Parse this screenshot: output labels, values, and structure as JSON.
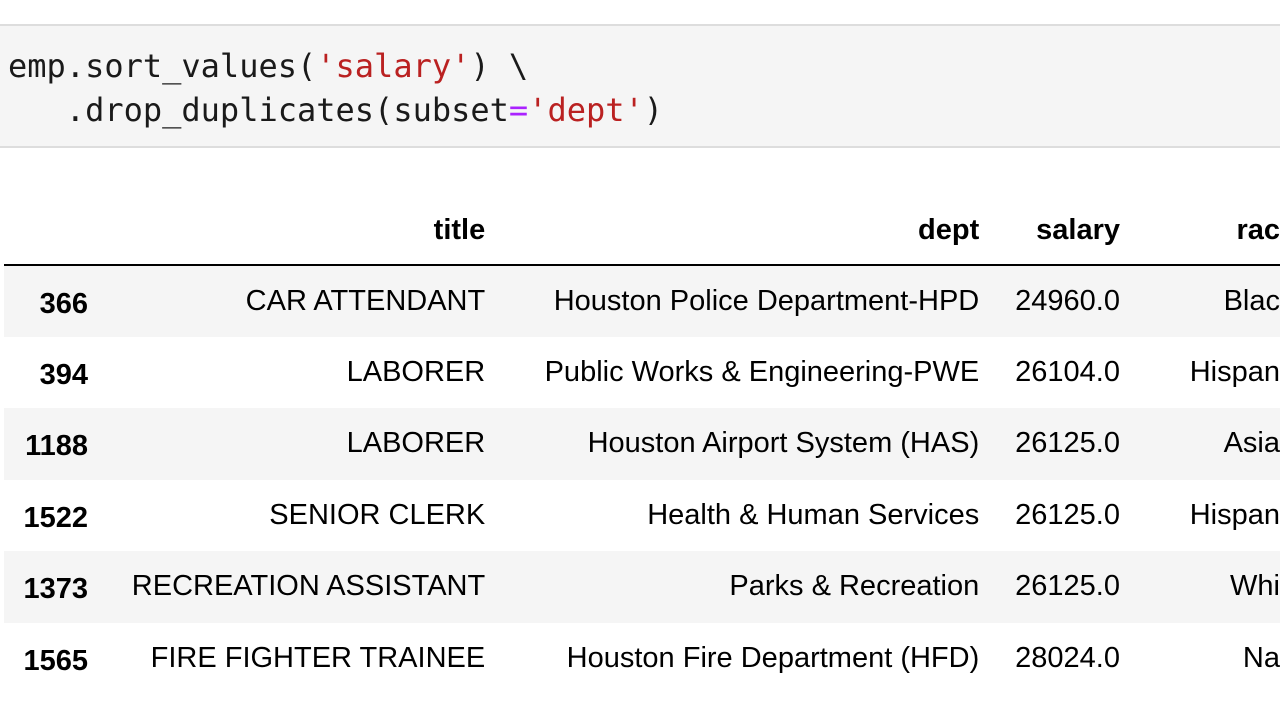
{
  "code": {
    "line1": {
      "pre": "emp.sort_values(",
      "str": "'salary'",
      "post": ") \\"
    },
    "line2": {
      "pre": "   .drop_duplicates(subset",
      "op": "=",
      "str": "'dept'",
      "post": ")"
    }
  },
  "table": {
    "columns": [
      "title",
      "dept",
      "salary",
      "rac"
    ],
    "rows": [
      {
        "index": "366",
        "title": "CAR ATTENDANT",
        "dept": "Houston Police Department-HPD",
        "salary": "24960.0",
        "race": "Blac"
      },
      {
        "index": "394",
        "title": "LABORER",
        "dept": "Public Works & Engineering-PWE",
        "salary": "26104.0",
        "race": "Hispan"
      },
      {
        "index": "1188",
        "title": "LABORER",
        "dept": "Houston Airport System (HAS)",
        "salary": "26125.0",
        "race": "Asia"
      },
      {
        "index": "1522",
        "title": "SENIOR CLERK",
        "dept": "Health & Human Services",
        "salary": "26125.0",
        "race": "Hispan"
      },
      {
        "index": "1373",
        "title": "RECREATION ASSISTANT",
        "dept": "Parks & Recreation",
        "salary": "26125.0",
        "race": "Whi"
      },
      {
        "index": "1565",
        "title": "FIRE FIGHTER TRAINEE",
        "dept": "Houston Fire Department (HFD)",
        "salary": "28024.0",
        "race": "Na"
      }
    ]
  }
}
